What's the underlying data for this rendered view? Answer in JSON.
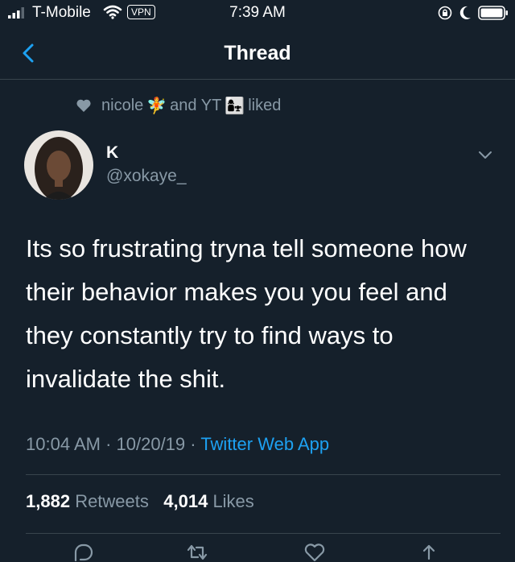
{
  "status_bar": {
    "carrier": "T-Mobile",
    "vpn": "VPN",
    "time": "7:39 AM"
  },
  "nav": {
    "title": "Thread"
  },
  "social_context": {
    "user1": "nicole",
    "user1_emoji": "🧚",
    "connector": "and YT",
    "user2_emoji": "👩‍👧",
    "action": "liked"
  },
  "tweet": {
    "display_name": "K",
    "handle": "@xokaye_",
    "text": "Its so frustrating tryna tell someone how their behavior makes you you feel and they constantly try to find ways to invalidate the shit.",
    "time": "10:04 AM",
    "date": "10/20/19",
    "source": "Twitter Web App",
    "separator": " · "
  },
  "stats": {
    "retweets_count": "1,882",
    "retweets_label": "Retweets",
    "likes_count": "4,014",
    "likes_label": "Likes"
  },
  "icons": {
    "back": "chevron-left-icon",
    "more": "chevron-down-icon",
    "reply": "reply-icon",
    "retweet": "retweet-icon",
    "like": "heart-icon",
    "share": "share-icon"
  },
  "colors": {
    "background": "#15202b",
    "accent": "#1da1f2",
    "secondary_text": "#8899a6",
    "divider": "#38444d"
  }
}
